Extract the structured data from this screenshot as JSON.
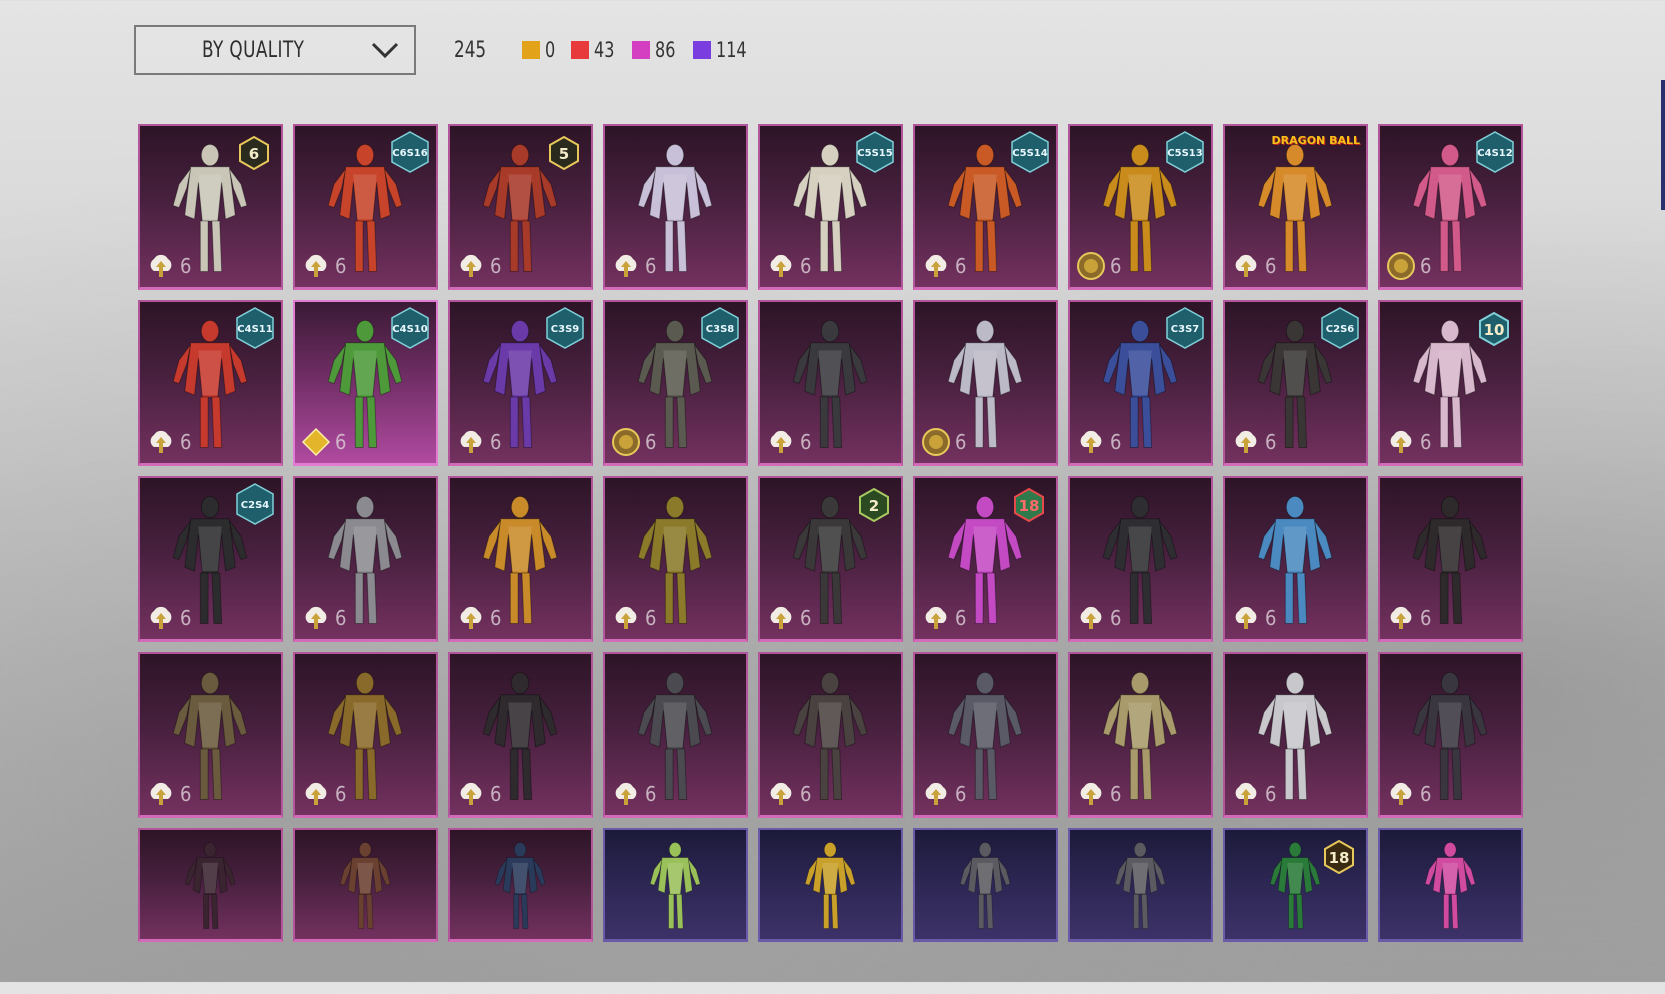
{
  "sort_dropdown": {
    "label": "BY QUALITY",
    "icon": "chevron-down-icon"
  },
  "total_count": "245",
  "legend": [
    {
      "count": "0",
      "color": "#e2a31a"
    },
    {
      "count": "43",
      "color": "#e83a3a"
    },
    {
      "count": "86",
      "color": "#d43ec0"
    },
    {
      "count": "114",
      "color": "#7a3de0"
    }
  ],
  "colors": {
    "tile_mythic": "#73315f",
    "tile_legendary_blue": "#3d3268",
    "tile_border": "#b3559b",
    "badge_teal": "#1f5e6b"
  },
  "items": [
    {
      "badge": "6",
      "badge_type": "circle",
      "icon": "upgrade-icon",
      "count": "6",
      "outfit": "#c9c6b8"
    },
    {
      "badge": "C6S16",
      "badge_type": "hex",
      "icon": "upgrade-icon",
      "count": "6",
      "outfit": "#c7442a"
    },
    {
      "badge": "5",
      "badge_type": "circle",
      "icon": "upgrade-icon",
      "count": "6",
      "outfit": "#a83a2a"
    },
    {
      "badge": "",
      "badge_type": "none",
      "icon": "upgrade-icon",
      "count": "6",
      "outfit": "#c8c0d8"
    },
    {
      "badge": "C5S15",
      "badge_type": "hex",
      "icon": "upgrade-icon",
      "count": "6",
      "outfit": "#d6d0c0"
    },
    {
      "badge": "C5S14",
      "badge_type": "hex",
      "icon": "upgrade-icon",
      "count": "6",
      "outfit": "#c95a26"
    },
    {
      "badge": "C5S13",
      "badge_type": "hex",
      "icon": "coin-icon",
      "count": "6",
      "outfit": "#c98c1c"
    },
    {
      "badge": "DRAGON BALL",
      "badge_type": "text",
      "icon": "upgrade-icon",
      "count": "6",
      "outfit": "#d78a2a"
    },
    {
      "badge": "C4S12",
      "badge_type": "hex",
      "icon": "coin-icon",
      "count": "6",
      "outfit": "#d15a8a"
    },
    {
      "badge": "C4S11",
      "badge_type": "hex",
      "icon": "upgrade-icon",
      "count": "6",
      "outfit": "#c63a2e"
    },
    {
      "badge": "C4S10",
      "badge_type": "hex",
      "icon": "diamond-icon",
      "count": "6",
      "outfit": "#4e9a3a"
    },
    {
      "badge": "C3S9",
      "badge_type": "hex",
      "icon": "upgrade-icon",
      "count": "6",
      "outfit": "#6a3aa8"
    },
    {
      "badge": "C3S8",
      "badge_type": "hex",
      "icon": "coin-icon",
      "count": "6",
      "outfit": "#5a5a50"
    },
    {
      "badge": "",
      "badge_type": "none",
      "icon": "upgrade-icon",
      "count": "6",
      "outfit": "#3a3a3e"
    },
    {
      "badge": "",
      "badge_type": "none",
      "icon": "coin-icon",
      "count": "6",
      "outfit": "#bdbac8"
    },
    {
      "badge": "C3S7",
      "badge_type": "hex",
      "icon": "upgrade-icon",
      "count": "6",
      "outfit": "#3a4e9a"
    },
    {
      "badge": "C2S6",
      "badge_type": "hex",
      "icon": "upgrade-icon",
      "count": "6",
      "outfit": "#3a3636"
    },
    {
      "badge": "10",
      "badge_type": "circle-teal",
      "icon": "upgrade-icon",
      "count": "6",
      "outfit": "#d8b8cc"
    },
    {
      "badge": "C2S4",
      "badge_type": "hex",
      "icon": "upgrade-icon",
      "count": "6",
      "outfit": "#2c2c2e"
    },
    {
      "badge": "",
      "badge_type": "none",
      "icon": "upgrade-icon",
      "count": "6",
      "outfit": "#8a8a90"
    },
    {
      "badge": "",
      "badge_type": "none",
      "icon": "upgrade-icon",
      "count": "6",
      "outfit": "#c98a2a"
    },
    {
      "badge": "",
      "badge_type": "none",
      "icon": "upgrade-icon",
      "count": "6",
      "outfit": "#8a7a2a"
    },
    {
      "badge": "2",
      "badge_type": "circle-green",
      "icon": "upgrade-icon",
      "count": "6",
      "outfit": "#3a3838"
    },
    {
      "badge": "18",
      "badge_type": "circle-red",
      "icon": "upgrade-icon",
      "count": "6",
      "outfit": "#c44ac4"
    },
    {
      "badge": "",
      "badge_type": "none",
      "icon": "upgrade-icon",
      "count": "6",
      "outfit": "#2e2e32"
    },
    {
      "badge": "",
      "badge_type": "none",
      "icon": "upgrade-icon",
      "count": "6",
      "outfit": "#4a8ac0"
    },
    {
      "badge": "",
      "badge_type": "none",
      "icon": "upgrade-icon",
      "count": "6",
      "outfit": "#2e2a2c"
    },
    {
      "badge": "",
      "badge_type": "none",
      "icon": "upgrade-icon",
      "count": "6",
      "outfit": "#6a5a3e"
    },
    {
      "badge": "",
      "badge_type": "none",
      "icon": "upgrade-icon",
      "count": "6",
      "outfit": "#8a6a2a"
    },
    {
      "badge": "",
      "badge_type": "none",
      "icon": "upgrade-icon",
      "count": "6",
      "outfit": "#2e2a2e"
    },
    {
      "badge": "",
      "badge_type": "none",
      "icon": "upgrade-icon",
      "count": "6",
      "outfit": "#4a4a50"
    },
    {
      "badge": "",
      "badge_type": "none",
      "icon": "upgrade-icon",
      "count": "6",
      "outfit": "#4a4240"
    },
    {
      "badge": "",
      "badge_type": "none",
      "icon": "upgrade-icon",
      "count": "6",
      "outfit": "#5a5a66"
    },
    {
      "badge": "",
      "badge_type": "none",
      "icon": "upgrade-icon",
      "count": "6",
      "outfit": "#a89a6a"
    },
    {
      "badge": "",
      "badge_type": "none",
      "icon": "upgrade-icon",
      "count": "6",
      "outfit": "#c8c8cc"
    },
    {
      "badge": "",
      "badge_type": "none",
      "icon": "upgrade-icon",
      "count": "6",
      "outfit": "#3a3640"
    },
    {
      "badge": "",
      "badge_type": "none",
      "icon": "none",
      "count": "",
      "outfit": "#3a2430"
    },
    {
      "badge": "",
      "badge_type": "none",
      "icon": "none",
      "count": "",
      "outfit": "#6a4030"
    },
    {
      "badge": "",
      "badge_type": "none",
      "icon": "none",
      "count": "",
      "outfit": "#2a3a5a"
    },
    {
      "badge": "",
      "badge_type": "none",
      "icon": "none",
      "count": "",
      "outfit": "#9ac05a"
    },
    {
      "badge": "",
      "badge_type": "none",
      "icon": "none",
      "count": "",
      "outfit": "#c8a02a"
    },
    {
      "badge": "",
      "badge_type": "none",
      "icon": "none",
      "count": "",
      "outfit": "#5a5a60"
    },
    {
      "badge": "",
      "badge_type": "none",
      "icon": "none",
      "count": "",
      "outfit": "#5a5a60"
    },
    {
      "badge": "18",
      "badge_type": "circle-gold",
      "icon": "none",
      "count": "",
      "outfit": "#2a7a3a"
    },
    {
      "badge": "",
      "badge_type": "none",
      "icon": "none",
      "count": "",
      "outfit": "#d04aa0"
    }
  ]
}
